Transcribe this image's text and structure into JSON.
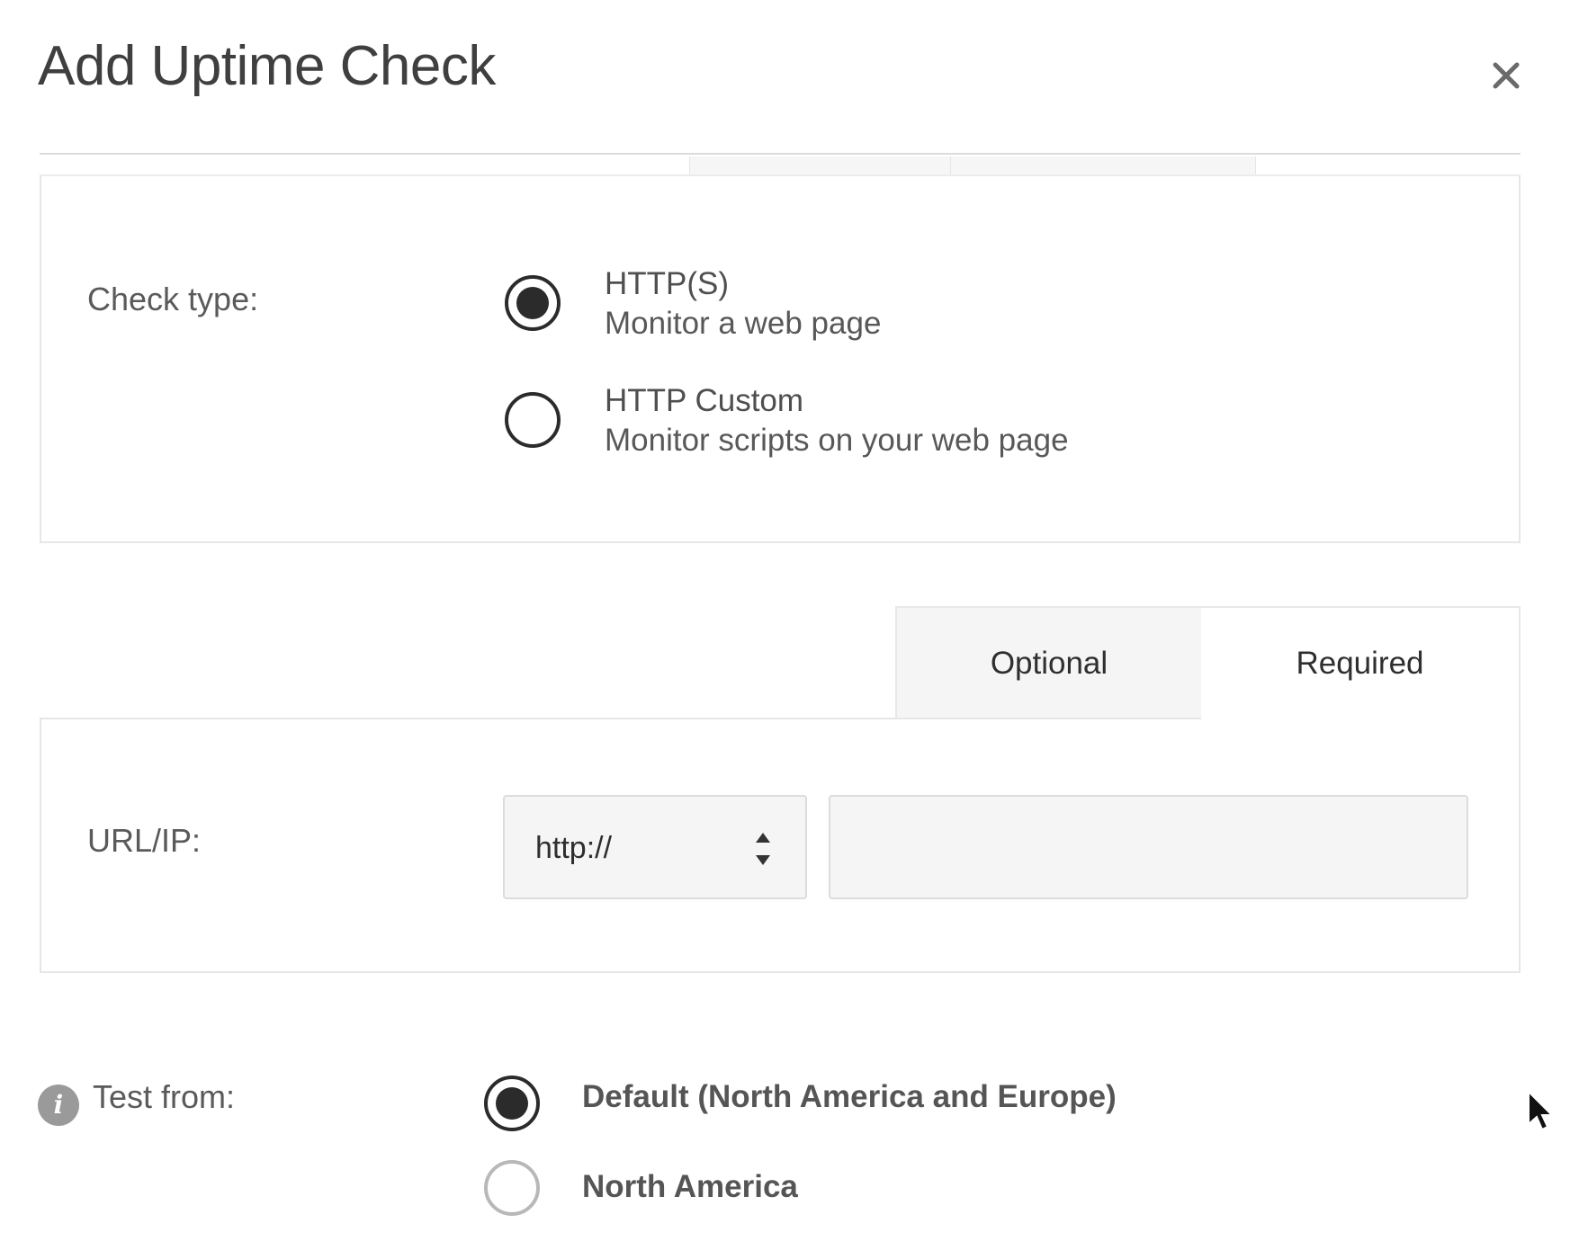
{
  "dialog": {
    "title": "Add Uptime Check",
    "close_icon": "close-icon"
  },
  "check_type": {
    "label": "Check type:",
    "options": [
      {
        "title": "HTTP(S)",
        "description": "Monitor a web page",
        "selected": true
      },
      {
        "title": "HTTP Custom",
        "description": "Monitor scripts on your web page",
        "selected": false
      }
    ]
  },
  "tabs": [
    {
      "label": "Optional",
      "active": false
    },
    {
      "label": "Required",
      "active": true
    }
  ],
  "url": {
    "label": "URL/IP:",
    "protocol_value": "http://",
    "address_value": "",
    "address_placeholder": ""
  },
  "test_from": {
    "label": "Test from:",
    "info_icon": "info-icon",
    "options": [
      {
        "label": "Default (North America and Europe)",
        "selected": true
      },
      {
        "label": "North America",
        "selected": false
      }
    ]
  },
  "colors": {
    "text": "#4a4a4a",
    "radio_selected": "#2b2b2b",
    "panel_border": "#e6e6e6",
    "input_bg": "#f5f5f5"
  }
}
